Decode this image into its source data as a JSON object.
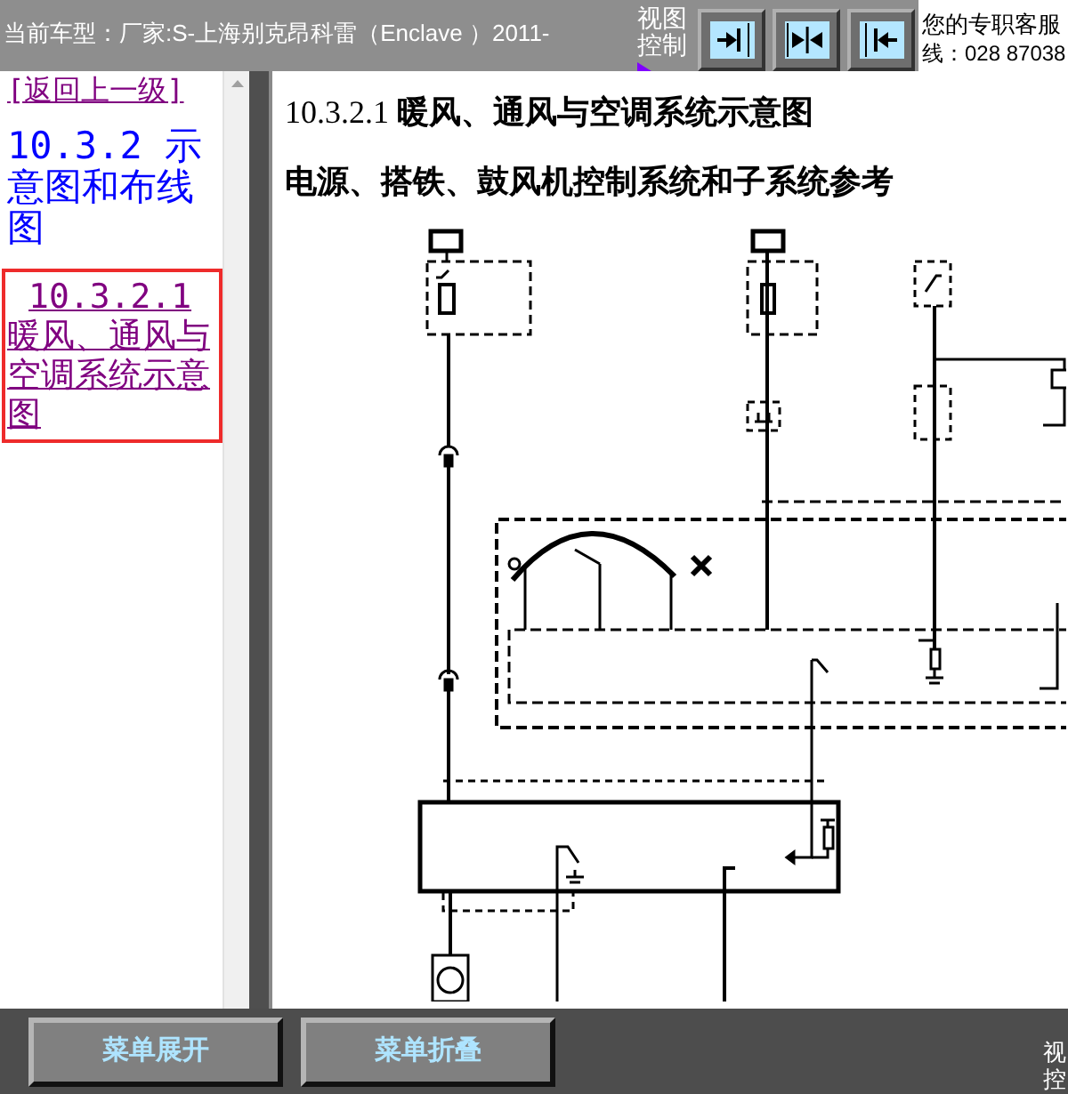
{
  "top_bar": {
    "vehicle": "当前车型：厂家:S-上海别克昂科雷（Enclave ）2011-",
    "view_control_label": "视图控制",
    "view_buttons": [
      {
        "kind": "right"
      },
      {
        "kind": "both"
      },
      {
        "kind": "left"
      }
    ],
    "support_text": [
      "您的专职客服",
      "线：028 87038"
    ]
  },
  "sidebar": {
    "back_link": "[返回上一级]",
    "items": [
      {
        "kind": "parent",
        "label": "10.3.2 示意图和布线图",
        "selected": false
      },
      {
        "kind": "child",
        "label": "10.3.2.1 暖风、通风与空调系统示意图",
        "selected": true
      }
    ]
  },
  "content": {
    "heading": "10.3.2.1 **暖风、通风与空调系统示意图**",
    "subheading": "电源、搭铁、鼓风机控制系统和子系统参考"
  },
  "bottom_bar": {
    "buttons": [
      "菜单展开",
      "菜单折叠"
    ],
    "cut_label": [
      "视",
      "控"
    ]
  }
}
